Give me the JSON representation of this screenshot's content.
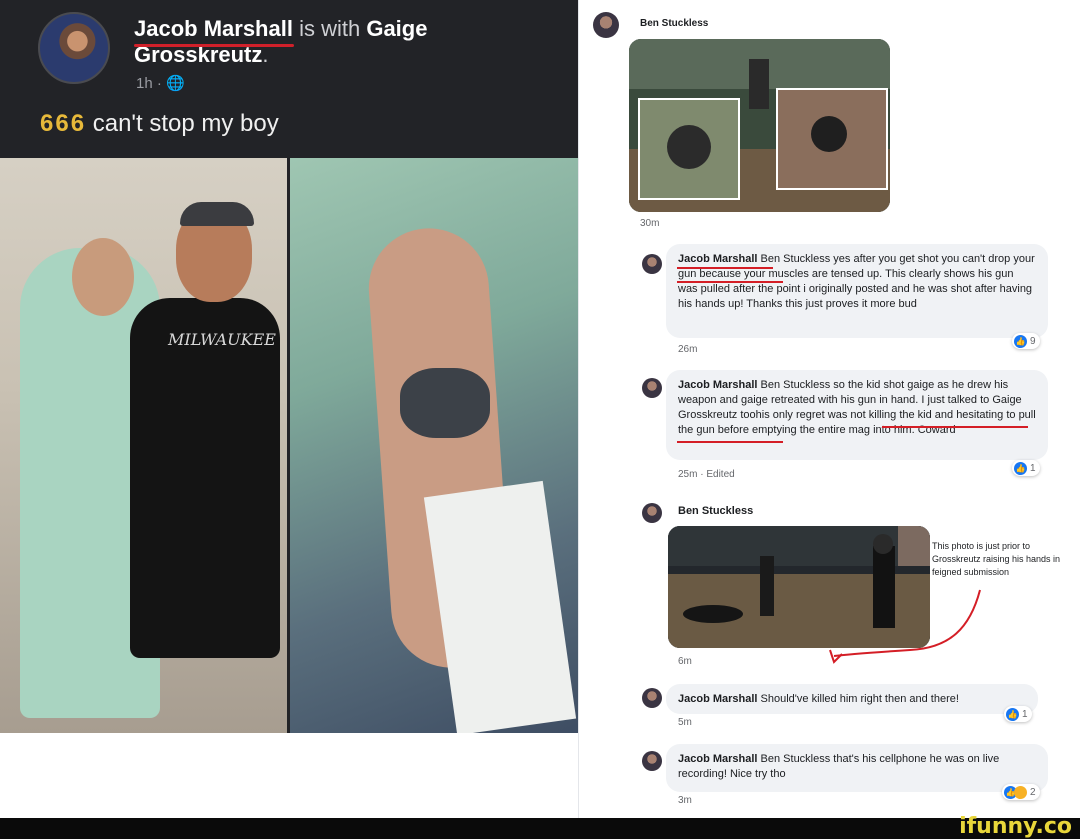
{
  "left_post": {
    "author": "Jacob Marshall",
    "with_text": "is with",
    "tagged": "Gaige Grosskreutz",
    "period": ".",
    "meta": "1h · 🌐",
    "emoji_text": "666",
    "body": "can't stop my boy",
    "shirt_text": "MILWAUKEE"
  },
  "comments": {
    "top_author": "Ben Stuckless",
    "top_time": "30m",
    "c1": {
      "author": "Jacob Marshall",
      "text": "Ben Stuckless yes after you get shot you can't drop your gun because your muscles are tensed up. This clearly shows his gun was pulled after the point i originally posted and he was shot after having his hands up! Thanks this just proves it more bud",
      "time": "26m",
      "reactions": "9"
    },
    "c2": {
      "author": "Jacob Marshall",
      "text": "Ben Stuckless so the kid shot gaige as he drew his weapon and gaige retreated with his gun in hand. I just talked to Gaige Grosskreutz toohis only regret was not killing the kid and hesitating to pull the gun before emptying the entire mag into him. Coward",
      "time": "25m · Edited",
      "reactions": "1"
    },
    "c3": {
      "author": "Ben Stuckless",
      "note": "This photo is just prior to Grosskreutz raising his hands in feigned submission",
      "time": "6m"
    },
    "c4": {
      "author": "Jacob Marshall",
      "text": "Should've killed him right then and there!",
      "time": "5m",
      "reactions": "1"
    },
    "c5": {
      "author": "Jacob Marshall",
      "text": "Ben Stuckless that's his cellphone he was on live recording! Nice try tho",
      "time": "3m",
      "reactions": "2"
    }
  },
  "watermark": "ifunny.co",
  "colors": {
    "dark_bg": "#222327",
    "like_blue": "#1877f2",
    "red_annot": "#d41e26",
    "watermark_yellow": "#e8d63a"
  },
  "icons": {
    "like": "thumbs-up-icon",
    "globe": "globe-icon"
  }
}
